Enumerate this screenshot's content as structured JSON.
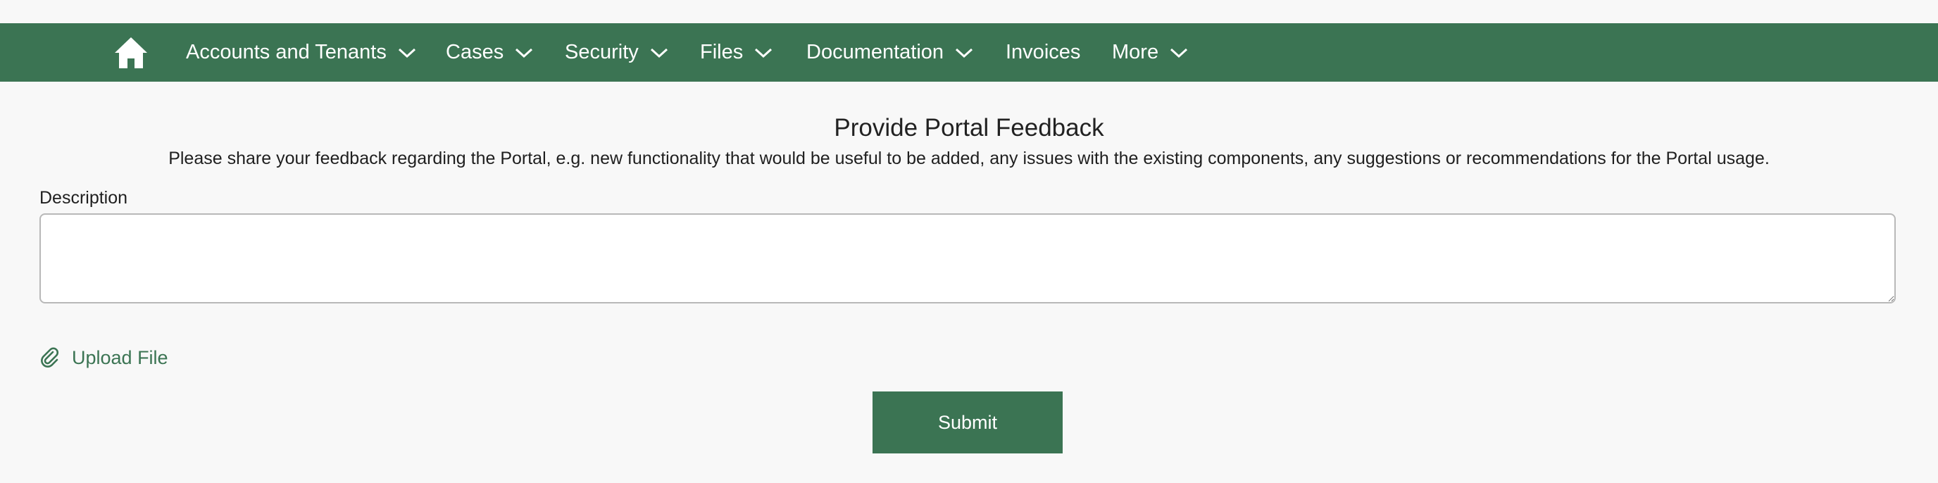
{
  "nav": {
    "home_icon": "home-icon",
    "items": [
      {
        "label": "Accounts and Tenants",
        "has_dropdown": true
      },
      {
        "label": "Cases",
        "has_dropdown": true
      },
      {
        "label": "Security",
        "has_dropdown": true
      },
      {
        "label": "Files",
        "has_dropdown": true
      },
      {
        "label": "Documentation",
        "has_dropdown": true
      },
      {
        "label": "Invoices",
        "has_dropdown": false
      },
      {
        "label": "More",
        "has_dropdown": true
      }
    ]
  },
  "form": {
    "title": "Provide Portal Feedback",
    "instructions": "Please share your feedback regarding the Portal, e.g. new functionality that would be useful to be added, any issues with the existing components, any suggestions or recommendations for the Portal usage.",
    "description_label": "Description",
    "description_value": "",
    "upload_label": "Upload File",
    "upload_icon": "paperclip-icon",
    "submit_label": "Submit"
  },
  "colors": {
    "brand_green": "#3b7453",
    "background": "#f8f8f8"
  }
}
